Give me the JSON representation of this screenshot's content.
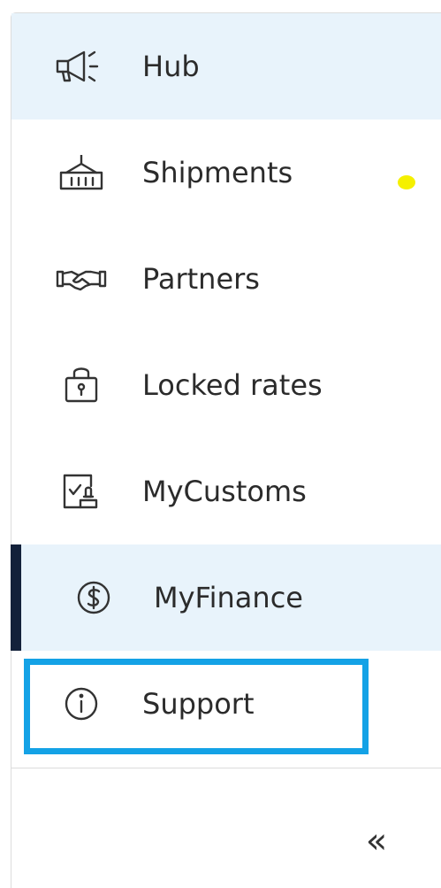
{
  "nav": {
    "items": [
      {
        "label": "Hub",
        "icon": "megaphone-icon",
        "highlighted": true
      },
      {
        "label": "Shipments",
        "icon": "container-icon"
      },
      {
        "label": "Partners",
        "icon": "handshake-icon"
      },
      {
        "label": "Locked rates",
        "icon": "lock-icon"
      },
      {
        "label": "MyCustoms",
        "icon": "customs-stamp-icon"
      },
      {
        "label": "MyFinance",
        "icon": "dollar-circle-icon",
        "active": true
      },
      {
        "label": "Support",
        "icon": "info-icon",
        "focused": true
      }
    ]
  },
  "footer": {
    "collapse_glyph": "«",
    "collapse_icon": "double-chevron-left-icon"
  },
  "colors": {
    "highlight_bg": "#e8f3fb",
    "active_bar": "#13213a",
    "focus_ring": "#14a2e6",
    "text": "#2b2b2b",
    "marker": "#f5f000"
  }
}
